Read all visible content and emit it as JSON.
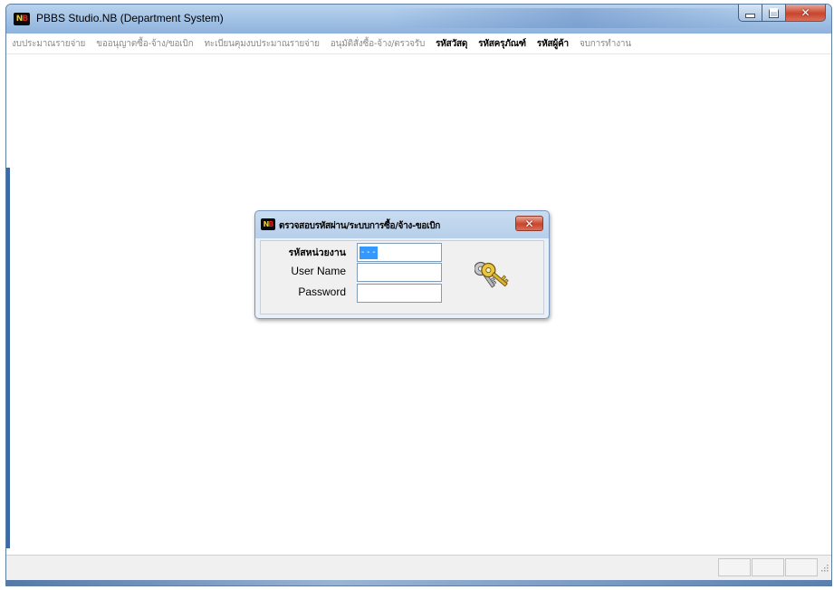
{
  "window": {
    "title": "PBBS Studio.NB (Department System)",
    "logo_text": "NB"
  },
  "menu": [
    {
      "label": "งบประมาณรายจ่าย",
      "enabled": false
    },
    {
      "label": "ขออนุญาตซื้อ-จ้าง/ขอเบิก",
      "enabled": false
    },
    {
      "label": "ทะเบียนคุมงบประมาณรายจ่าย",
      "enabled": false
    },
    {
      "label": "อนุมัติสั่งซื้อ-จ้าง/ตรวจรับ",
      "enabled": false
    },
    {
      "label": "รหัสวัสดุ",
      "enabled": true
    },
    {
      "label": "รหัสครุภัณฑ์",
      "enabled": true
    },
    {
      "label": "รหัสผู้ค้า",
      "enabled": true
    },
    {
      "label": "จบการทำงาน",
      "enabled": false
    }
  ],
  "dialog": {
    "title": "ตรวจสอบรหัสผ่าน/ระบบการซื้อ/จ้าง-ขอเบิก",
    "fields": [
      {
        "label": "รหัสหน่วยงาน",
        "value": "- - -"
      },
      {
        "label": "User Name",
        "value": ""
      },
      {
        "label": "Password",
        "value": ""
      }
    ]
  },
  "icons": {
    "dialog_graphic": "keys-icon",
    "close": "close-icon"
  },
  "colors": {
    "titlebar": "#a5c4e6",
    "close_button": "#c9442c",
    "selection": "#3399ff",
    "menu_disabled": "#8a8a8a"
  }
}
